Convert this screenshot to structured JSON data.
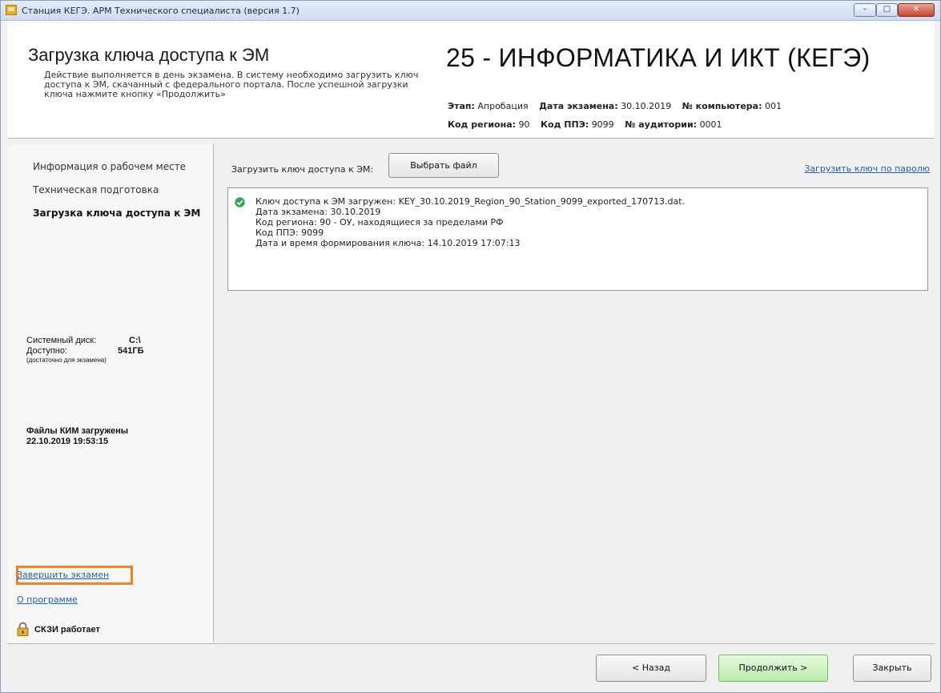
{
  "window": {
    "title": "Станция КЕГЭ. АРМ Технического специалиста (версия 1.7)",
    "controls": {
      "minimize": "–",
      "maximize": "□",
      "close": "✕"
    }
  },
  "header": {
    "title": "Загрузка ключа доступа к ЭМ",
    "description": "Действие выполняется в день экзамена. В систему необходимо загрузить ключ доступа к ЭМ, скачанный с федерального портала. После успешной загрузки ключа нажмите кнопку «Продолжить»",
    "subject": "25 - ИНФОРМАТИКА И ИКТ (КЕГЭ)",
    "meta": {
      "stage_label": "Этап:",
      "stage_value": "Апробация",
      "date_label": "Дата экзамена:",
      "date_value": "30.10.2019",
      "computer_label": "№ компьютера:",
      "computer_value": "001",
      "region_label": "Код региона:",
      "region_value": "90",
      "ppe_label": "Код ППЭ:",
      "ppe_value": "9099",
      "room_label": "№ аудитории:",
      "room_value": "0001"
    }
  },
  "sidebar": {
    "items": [
      {
        "label": "Информация о рабочем месте"
      },
      {
        "label": "Техническая подготовка"
      },
      {
        "label": "Загрузка ключа доступа к ЭМ"
      }
    ],
    "disk": {
      "system_label": "Системный диск:",
      "system_value": "C:\\",
      "free_label": "Доступно:",
      "free_value": "541ГБ",
      "note": "(достаточно для экзамена)"
    },
    "kim": {
      "line1": "Файлы КИМ загружены",
      "line2": "22.10.2019 19:53:15"
    },
    "finish_link": "Завершить экзамен",
    "about_link": "О программе",
    "skzi_status": "СКЗИ работает"
  },
  "main": {
    "load_label": "Загрузить ключ доступа к ЭМ:",
    "choose_file_button": "Выбрать файл",
    "load_by_password_link": "Загрузить ключ по паролю",
    "info_lines": [
      "Ключ доступа к ЭМ загружен: KEY_30.10.2019_Region_90_Station_9099_exported_170713.dat.",
      "Дата экзамена: 30.10.2019",
      "Код региона: 90 - ОУ, находящиеся за пределами РФ",
      "Код ППЭ: 9099",
      "Дата и время формирования ключа: 14.10.2019 17:07:13"
    ]
  },
  "footer": {
    "back_button": "< Назад",
    "next_button": "Продолжить >",
    "close_button": "Закрыть"
  },
  "colors": {
    "accent_link": "#1f5fbf",
    "highlight_outline": "#f08326",
    "next_button": "#b8ebaa",
    "success_check": "#3aa655"
  },
  "icons": {
    "app": "app-window-icon",
    "success": "check-circle-icon",
    "lock": "lock-icon"
  }
}
